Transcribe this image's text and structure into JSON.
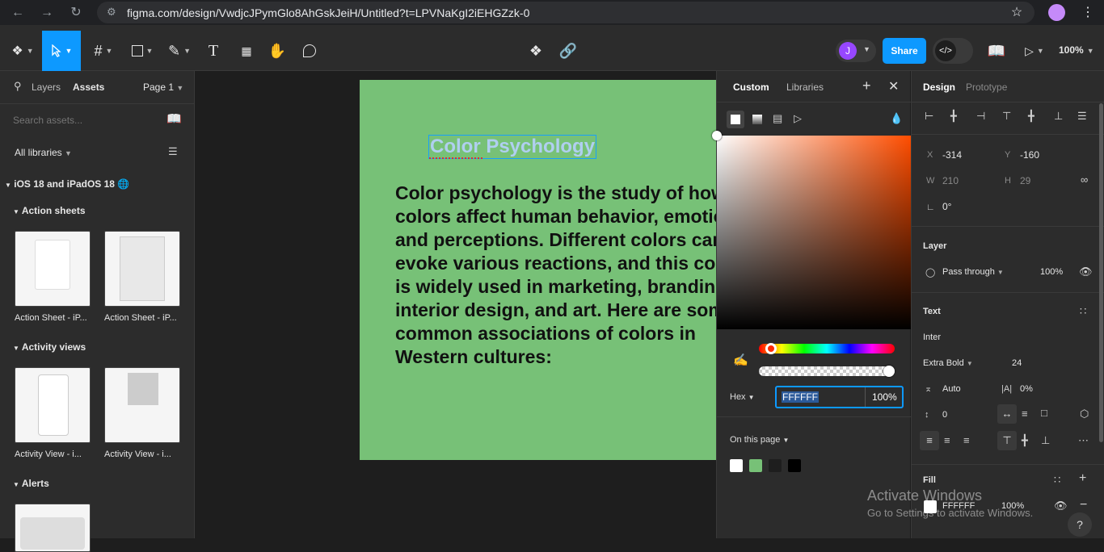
{
  "browser": {
    "url": "figma.com/design/VwdjcJPymGlo8AhGskJeiH/Untitled?t=LPVNaKgI2iEHGZzk-0"
  },
  "toolbar": {
    "share_label": "Share",
    "zoom_label": "100%",
    "avatar_initial": "J"
  },
  "left_panel": {
    "tabs": [
      "Layers",
      "Assets"
    ],
    "page_label": "Page 1",
    "search_placeholder": "Search assets...",
    "libraries_filter": "All libraries",
    "library_name": "iOS 18 and iPadOS 18",
    "sections": [
      {
        "title": "Action sheets",
        "items": [
          "Action Sheet - iP...",
          "Action Sheet - iP..."
        ]
      },
      {
        "title": "Activity views",
        "items": [
          "Activity View - i...",
          "Activity View - i..."
        ]
      },
      {
        "title": "Alerts",
        "items": []
      }
    ]
  },
  "canvas": {
    "heading": "Color Psychology",
    "body": "Color psychology is the study of how colors affect human behavior, emotions, and perceptions. Different colors can evoke various reactions, and this concept is widely used in marketing, branding, interior design, and art. Here are some common associations of colors in Western cultures:",
    "frame_color": "#77c177"
  },
  "picker": {
    "tabs": [
      "Custom",
      "Libraries"
    ],
    "mode_label": "Hex",
    "hex_value": "FFFFFF",
    "opacity_value": "100%",
    "on_page_label": "On this page",
    "swatches": [
      "#ffffff",
      "#77c177",
      "#1e1e1e",
      "#000000"
    ]
  },
  "right_panel": {
    "tabs": [
      "Design",
      "Prototype"
    ],
    "x_label": "X",
    "x_value": "-314",
    "y_label": "Y",
    "y_value": "-160",
    "w_label": "W",
    "w_value": "210",
    "h_label": "H",
    "h_value": "29",
    "rotation_value": "0°",
    "layer_title": "Layer",
    "blend_mode": "Pass through",
    "layer_opacity": "100%",
    "text_title": "Text",
    "font_family": "Inter",
    "font_weight": "Extra Bold",
    "font_size": "24",
    "line_height": "Auto",
    "letter_spacing": "0%",
    "paragraph_spacing": "0",
    "fill_title": "Fill",
    "fill_hex": "FFFFFF",
    "fill_opacity": "100%"
  },
  "watermark": {
    "line1": "Activate Windows",
    "line2": "Go to Settings to activate Windows."
  }
}
